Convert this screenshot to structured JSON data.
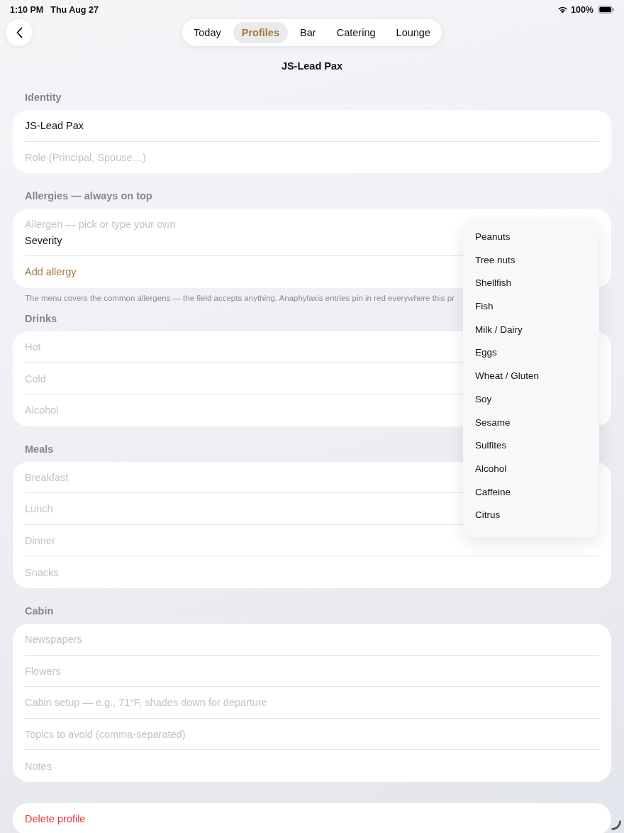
{
  "status_bar": {
    "time": "1:10 PM",
    "date": "Thu Aug 27",
    "battery": "100%"
  },
  "tabs": [
    {
      "label": "Today",
      "selected": false
    },
    {
      "label": "Profiles",
      "selected": true
    },
    {
      "label": "Bar",
      "selected": false
    },
    {
      "label": "Catering",
      "selected": false
    },
    {
      "label": "Lounge",
      "selected": false
    }
  ],
  "title": "JS-Lead Pax",
  "identity": {
    "header": "Identity",
    "fields": [
      {
        "value": "JS-Lead Pax"
      },
      {
        "placeholder": "Role (Principal, Spouse…)"
      }
    ]
  },
  "allergies": {
    "header": "Allergies — always on top",
    "allergen_field": {
      "placeholder": "Allergen — pick or type your own"
    },
    "severity_label": "Severity",
    "add_button": "Add allergy",
    "note": "The menu covers the common allergens — the field accepts anything. Anaphylaxis entries pin in red everywhere this pr",
    "menu": {
      "items": [
        {
          "label": "Peanuts",
          "selected": false
        },
        {
          "label": "Tree nuts",
          "selected": false
        },
        {
          "label": "Shellfish",
          "selected": false
        },
        {
          "label": "Fish",
          "selected": false
        },
        {
          "label": "Milk / Dairy",
          "selected": false
        },
        {
          "label": "Eggs",
          "selected": false
        },
        {
          "label": "Wheat / Gluten",
          "selected": false
        },
        {
          "label": "Soy",
          "selected": false
        },
        {
          "label": "Sesame",
          "selected": false
        },
        {
          "label": "Sulfites",
          "selected": false
        },
        {
          "label": "Alcohol",
          "selected": false
        },
        {
          "label": "Caffeine",
          "selected": false
        },
        {
          "label": "Citrus",
          "selected": false
        }
      ]
    }
  },
  "drinks": {
    "header": "Drinks",
    "fields": [
      {
        "placeholder": "Hot"
      },
      {
        "placeholder": "Cold"
      },
      {
        "placeholder": "Alcohol"
      }
    ]
  },
  "meals": {
    "header": "Meals",
    "fields": [
      {
        "placeholder": "Breakfast"
      },
      {
        "placeholder": "Lunch"
      },
      {
        "placeholder": "Dinner"
      },
      {
        "placeholder": "Snacks"
      }
    ]
  },
  "cabin": {
    "header": "Cabin",
    "fields": [
      {
        "placeholder": "Newspapers"
      },
      {
        "placeholder": "Flowers"
      },
      {
        "placeholder": "Cabin setup — e.g., 71°F, shades down for departure"
      },
      {
        "placeholder": "Topics to avoid (comma-separated)"
      },
      {
        "placeholder": "Notes"
      }
    ]
  },
  "delete_button": "Delete profile"
}
